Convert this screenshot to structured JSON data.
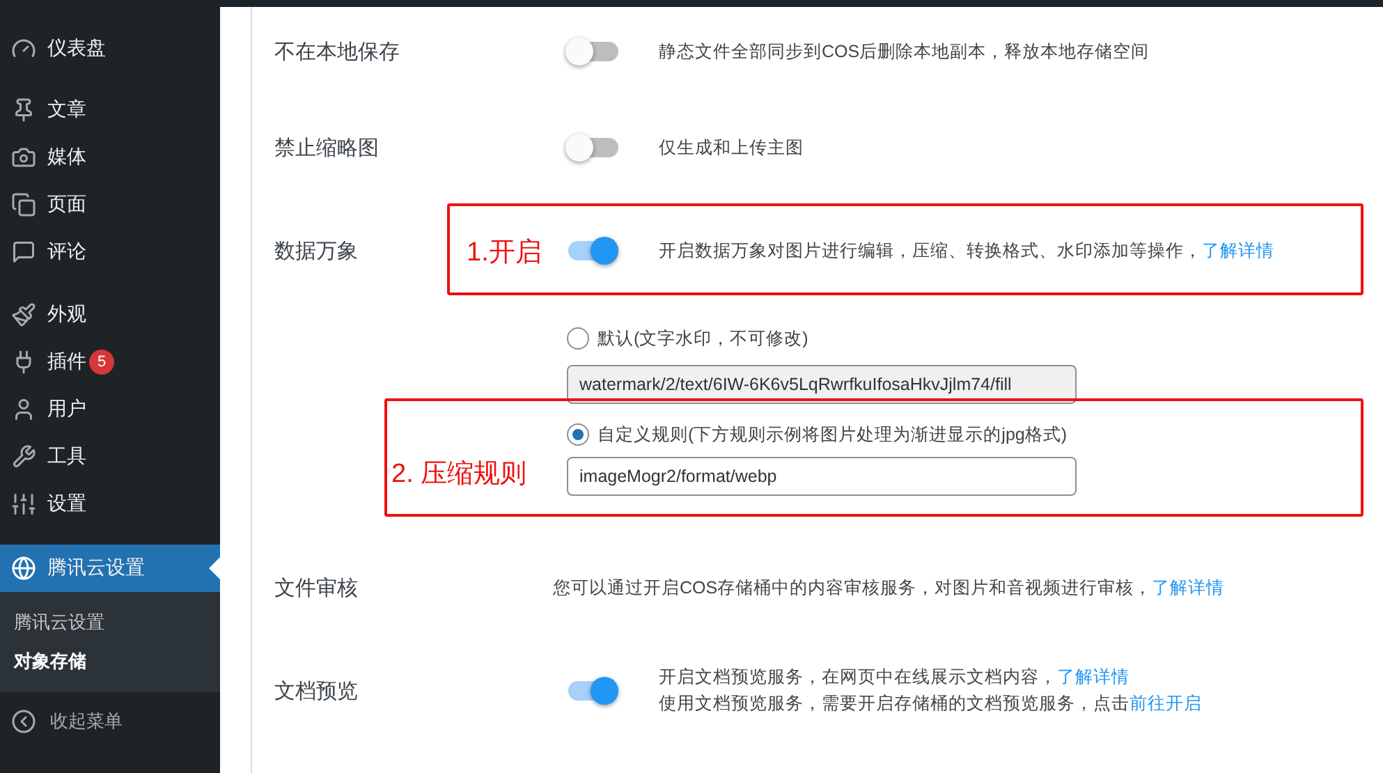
{
  "sidebar": {
    "items": [
      {
        "label": "仪表盘",
        "selected": false
      },
      {
        "label": "文章",
        "selected": false
      },
      {
        "label": "媒体",
        "selected": false
      },
      {
        "label": "页面",
        "selected": false
      },
      {
        "label": "评论",
        "selected": false
      },
      {
        "label": "外观",
        "selected": false
      },
      {
        "label": "插件",
        "selected": false,
        "badge": "5"
      },
      {
        "label": "用户",
        "selected": false
      },
      {
        "label": "工具",
        "selected": false
      },
      {
        "label": "设置",
        "selected": false
      },
      {
        "label": "腾讯云设置",
        "selected": true,
        "children": [
          {
            "label": "腾讯云设置",
            "selected": false
          },
          {
            "label": "对象存储",
            "selected": true
          }
        ]
      }
    ],
    "collapse_label": "收起菜单"
  },
  "settings": [
    {
      "kind": "toggle",
      "label": "不在本地保存",
      "on": false,
      "lines": [
        {
          "text": "静态文件全部同步到COS后删除本地副本，释放本地存储空间"
        }
      ]
    },
    {
      "kind": "toggle",
      "label": "禁止缩略图",
      "on": false,
      "lines": [
        {
          "text": "仅生成和上传主图"
        }
      ]
    },
    {
      "kind": "toggle",
      "label": "数据万象",
      "on": true,
      "annotation": "1.开启",
      "lines": [
        {
          "text": "开启数据万象对图片进行编辑，压缩、转换格式、水印添加等操作，",
          "link": "了解详情"
        }
      ]
    },
    {
      "kind": "rules",
      "options": [
        {
          "label": "默认(文字水印，不可修改)",
          "selected": false,
          "value": "watermark/2/text/6IW-6K6v5LqRwrfkuIfosaHkvJjlm74/fill",
          "disabled": true
        },
        {
          "label": "自定义规则(下方规则示例将图片处理为渐进显示的jpg格式)",
          "selected": true,
          "value": "imageMogr2/format/webp",
          "disabled": false,
          "annotation": "2. 压缩规则"
        }
      ]
    },
    {
      "kind": "info",
      "label": "文件审核",
      "lines": [
        {
          "text": "您可以通过开启COS存储桶中的内容审核服务，对图片和音视频进行审核，",
          "link": "了解详情"
        }
      ]
    },
    {
      "kind": "toggle",
      "label": "文档预览",
      "on": true,
      "lines": [
        {
          "text": "开启文档预览服务，在网页中在线展示文档内容，",
          "link": "了解详情"
        },
        {
          "text": "使用文档预览服务，需要开启存储桶的文档预览服务，点击",
          "link": "前往开启"
        }
      ]
    }
  ]
}
